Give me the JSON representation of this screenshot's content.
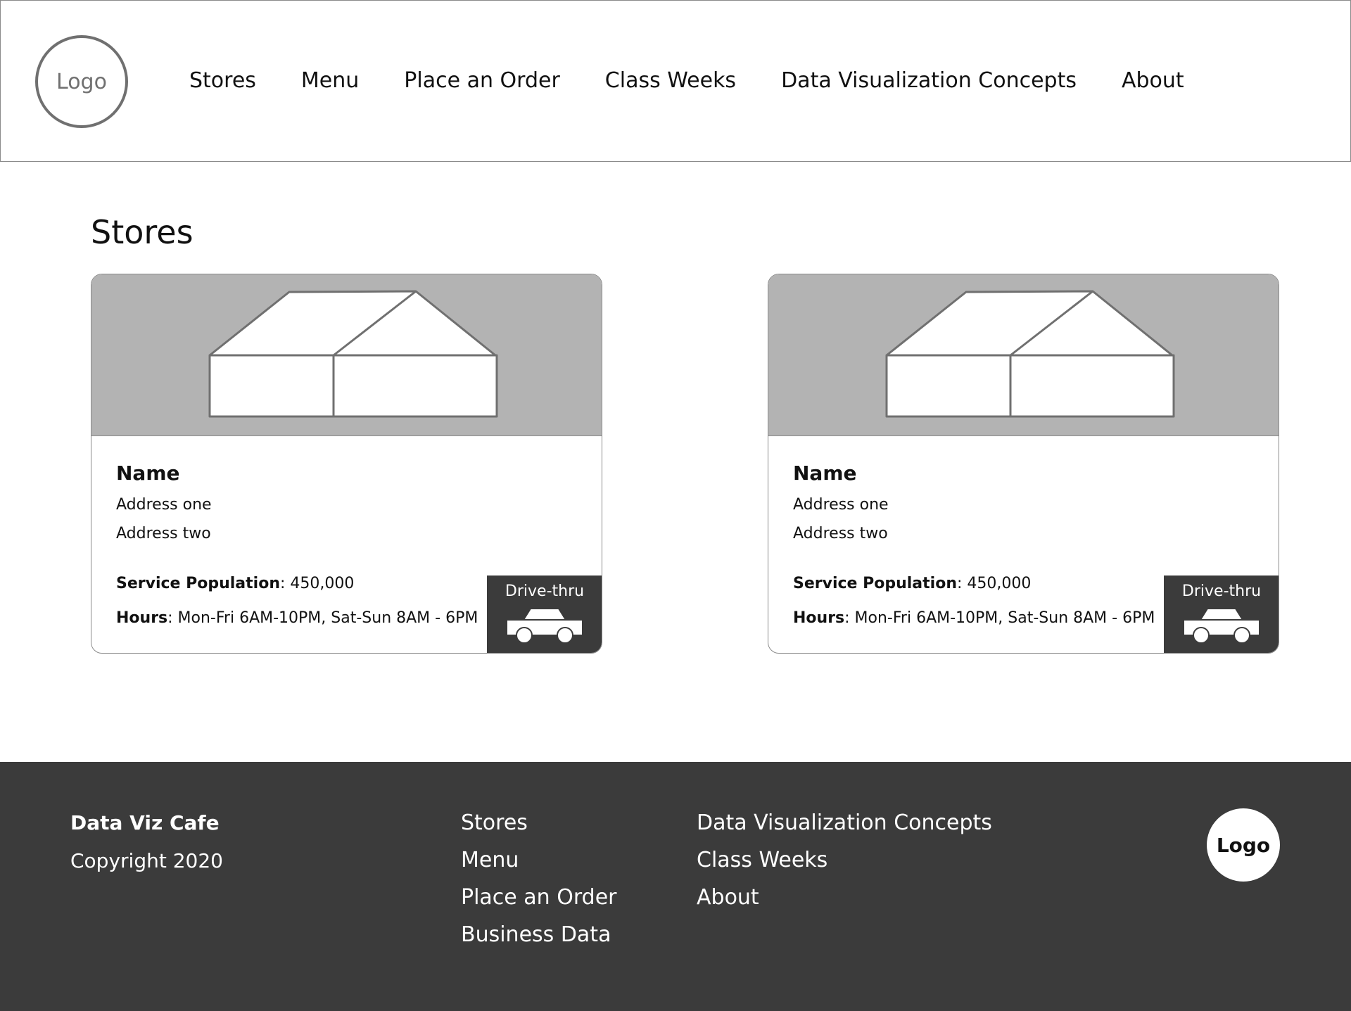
{
  "header": {
    "logo_label": "Logo",
    "nav": [
      {
        "label": "Stores"
      },
      {
        "label": "Menu"
      },
      {
        "label": "Place an Order"
      },
      {
        "label": "Class Weeks"
      },
      {
        "label": "Data Visualization Concepts"
      },
      {
        "label": "About"
      }
    ]
  },
  "main": {
    "title": "Stores",
    "stores": [
      {
        "name": "Name",
        "address_one": "Address one",
        "address_two": "Address two",
        "population_label": "Service Population",
        "population_value": ": 450,000",
        "hours_label": "Hours",
        "hours_value": ": Mon-Fri 6AM-10PM, Sat-Sun 8AM - 6PM",
        "image_icon": "store-building-icon",
        "badge": {
          "label": "Drive-thru",
          "icon": "car-icon"
        }
      },
      {
        "name": "Name",
        "address_one": "Address one",
        "address_two": "Address two",
        "population_label": "Service Population",
        "population_value": ": 450,000",
        "hours_label": "Hours",
        "hours_value": ": Mon-Fri 6AM-10PM, Sat-Sun 8AM - 6PM",
        "image_icon": "store-building-icon",
        "badge": {
          "label": "Drive-thru",
          "icon": "car-icon"
        }
      }
    ]
  },
  "footer": {
    "brand": "Data Viz Cafe",
    "copyright": "Copyright 2020",
    "links_col1": [
      {
        "label": "Stores"
      },
      {
        "label": "Menu"
      },
      {
        "label": "Place an Order"
      },
      {
        "label": "Business Data"
      }
    ],
    "links_col2": [
      {
        "label": "Data Visualization Concepts"
      },
      {
        "label": "Class Weeks"
      },
      {
        "label": "About"
      }
    ],
    "logo_label": "Logo"
  },
  "colors": {
    "footer_bg": "#3b3b3b",
    "image_placeholder_bg": "#b3b3b3",
    "border": "#8a8a8a",
    "logo_outline": "#707070"
  }
}
